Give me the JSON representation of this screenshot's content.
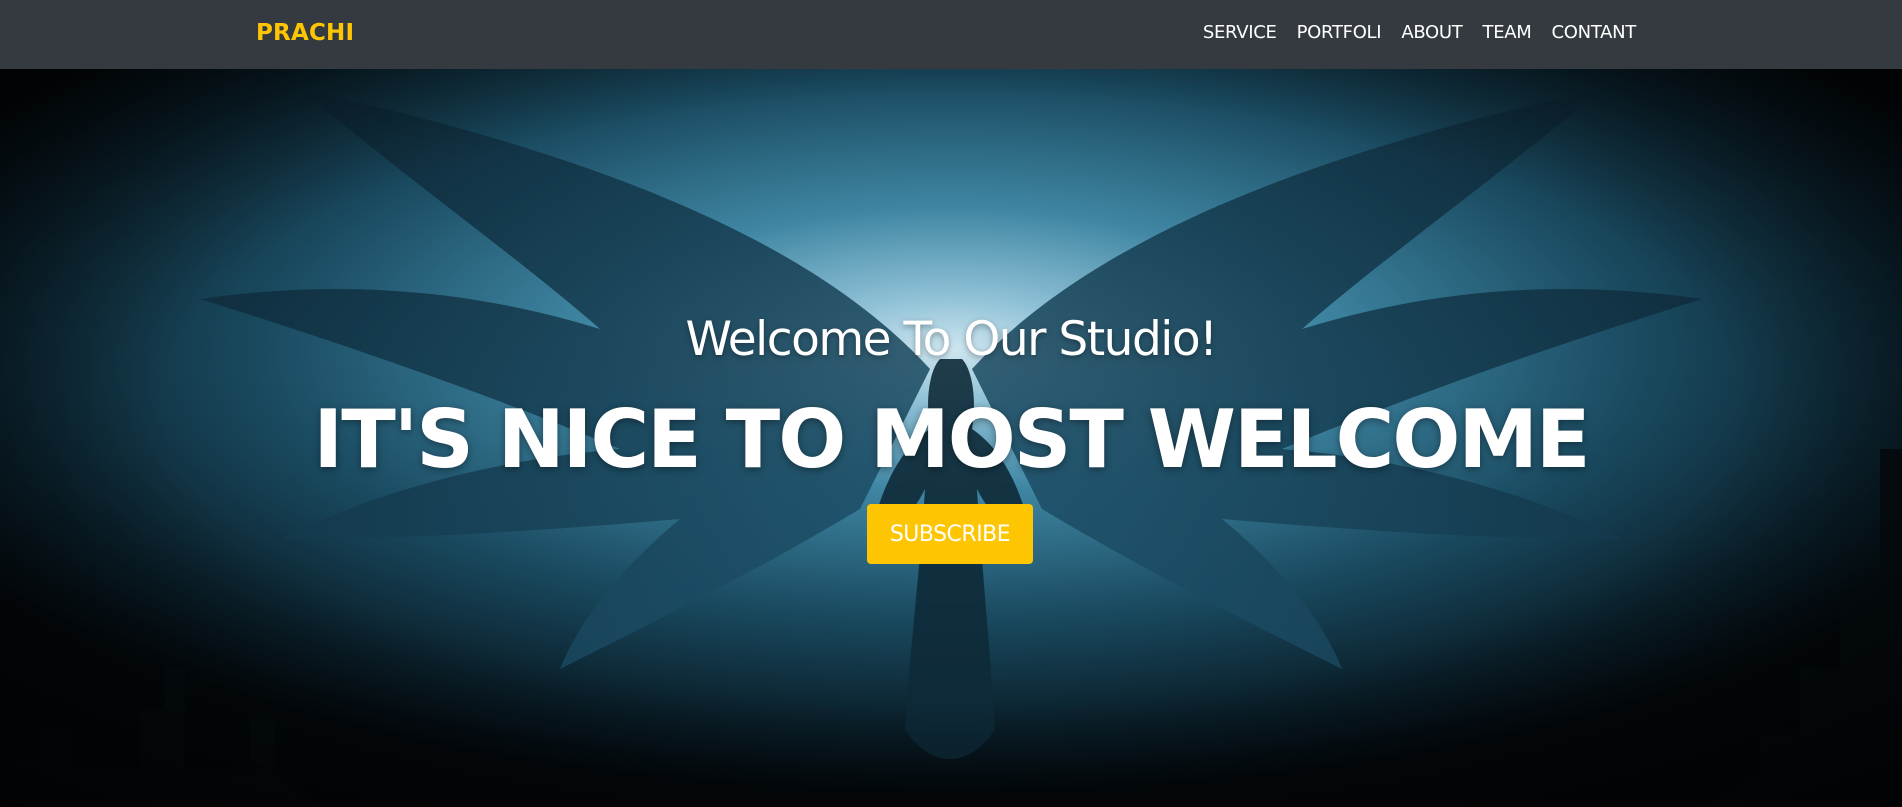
{
  "navbar": {
    "brand": "PRACHI",
    "links": [
      "SERVICE",
      "PORTFOLI",
      "ABOUT",
      "TEAM",
      "CONTANT"
    ]
  },
  "hero": {
    "subheading": "Welcome To Our Studio!",
    "heading": "IT'S NICE TO MOST WELCOME",
    "button_label": "SUBSCRIBE",
    "background_image": "dark-winged-angel-artwork"
  },
  "colors": {
    "navbar_bg": "#343a40",
    "accent": "#fec503",
    "text": "#ffffff"
  }
}
